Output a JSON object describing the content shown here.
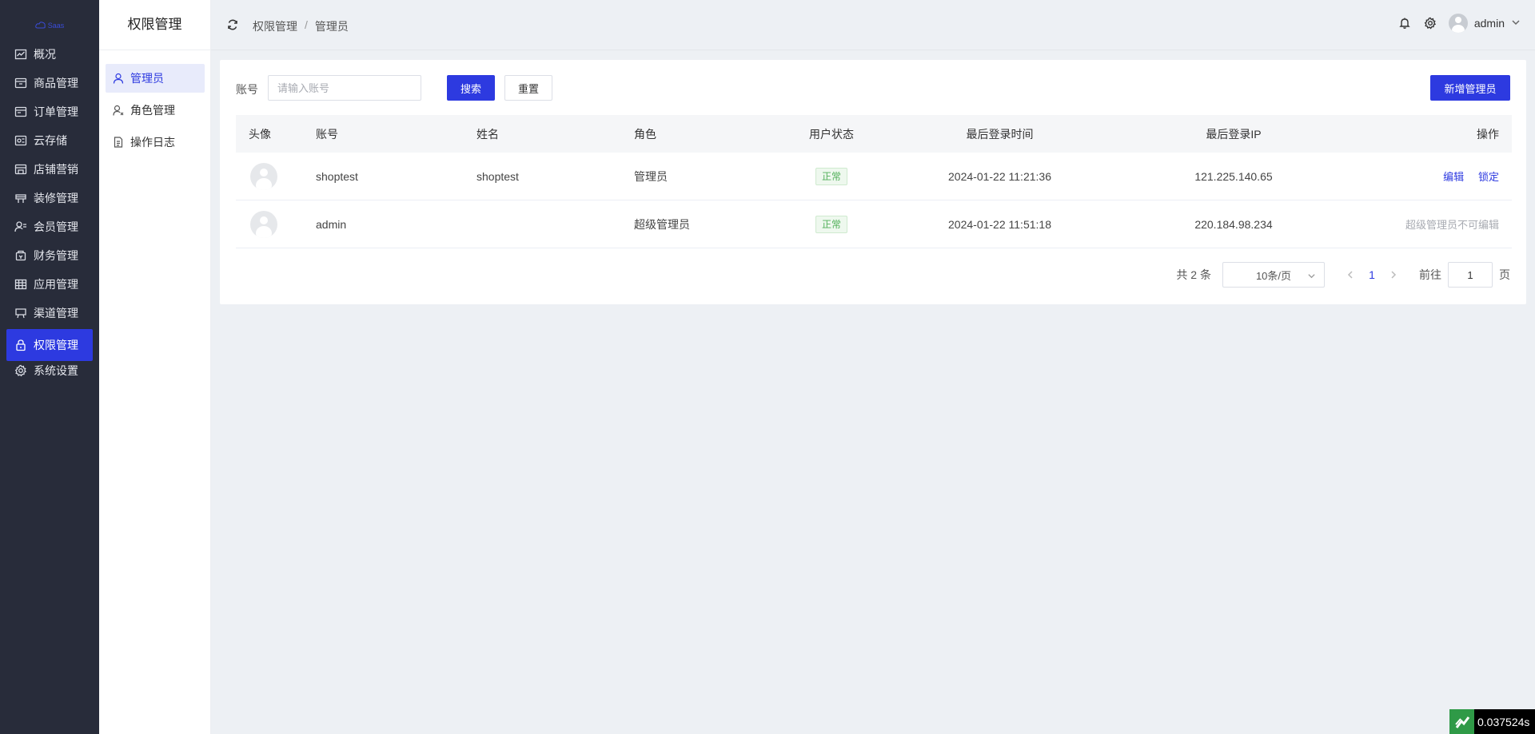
{
  "logo": {
    "text": "Saas"
  },
  "nav": {
    "items": [
      {
        "label": "概况",
        "icon": "chart-icon"
      },
      {
        "label": "商品管理",
        "icon": "box-icon"
      },
      {
        "label": "订单管理",
        "icon": "order-icon"
      },
      {
        "label": "云存储",
        "icon": "cloud-storage-icon"
      },
      {
        "label": "店铺营销",
        "icon": "store-icon"
      },
      {
        "label": "装修管理",
        "icon": "decorate-icon"
      },
      {
        "label": "会员管理",
        "icon": "member-icon"
      },
      {
        "label": "财务管理",
        "icon": "finance-icon"
      },
      {
        "label": "应用管理",
        "icon": "apps-icon"
      },
      {
        "label": "渠道管理",
        "icon": "channel-icon"
      },
      {
        "label": "权限管理",
        "icon": "lock-icon"
      },
      {
        "label": "系统设置",
        "icon": "gear-icon"
      }
    ],
    "active": "权限管理"
  },
  "subnav": {
    "title": "权限管理",
    "items": [
      {
        "label": "管理员",
        "icon": "user-icon"
      },
      {
        "label": "角色管理",
        "icon": "role-icon"
      },
      {
        "label": "操作日志",
        "icon": "log-icon"
      }
    ],
    "active": "管理员"
  },
  "header": {
    "breadcrumb": [
      "权限管理",
      "管理员"
    ],
    "separator": "/",
    "username": "admin"
  },
  "search": {
    "label": "账号",
    "placeholder": "请输入账号",
    "value": "",
    "search_button": "搜索",
    "reset_button": "重置",
    "add_button": "新增管理员"
  },
  "table": {
    "columns": [
      "头像",
      "账号",
      "姓名",
      "角色",
      "用户状态",
      "最后登录时间",
      "最后登录IP",
      "操作"
    ],
    "rows": [
      {
        "account": "shoptest",
        "name": "shoptest",
        "role": "管理员",
        "status": "正常",
        "last_login": "2024-01-22 11:21:36",
        "ip": "121.225.140.65",
        "actions": [
          "编辑",
          "锁定"
        ],
        "note": ""
      },
      {
        "account": "admin",
        "name": "",
        "role": "超级管理员",
        "status": "正常",
        "last_login": "2024-01-22 11:51:18",
        "ip": "220.184.98.234",
        "actions": [],
        "note": "超级管理员不可编辑"
      }
    ]
  },
  "pagination": {
    "total_text": "共 2 条",
    "page_size": "10条/页",
    "current_page": "1",
    "goto_label": "前往",
    "goto_value": "1",
    "page_suffix": "页"
  },
  "perf": {
    "time": "0.037524s"
  },
  "colors": {
    "accent": "#2d3ae0",
    "sidebar_bg": "#282c3a",
    "status_green": "#52b05a"
  }
}
